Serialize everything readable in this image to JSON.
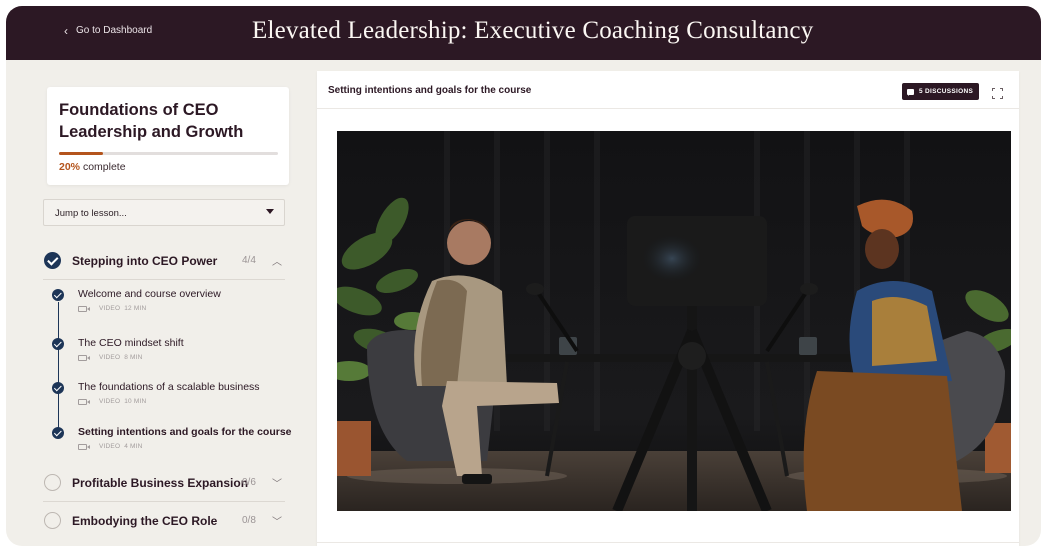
{
  "header": {
    "back_label": "Go to Dashboard",
    "app_title": "Elevated Leadership: Executive Coaching Consultancy"
  },
  "course": {
    "title": "Foundations of CEO Leadership and Growth",
    "progress_pct_label": "20%",
    "progress_text": "complete",
    "progress_fraction": 0.2
  },
  "jump": {
    "label": "Jump to lesson..."
  },
  "modules": [
    {
      "title": "Stepping into CEO Power",
      "count": "4/4",
      "state": "complete",
      "expanded": true,
      "lessons": [
        {
          "title": "Welcome and course overview",
          "type": "VIDEO",
          "duration": "12 MIN"
        },
        {
          "title": "The CEO mindset shift",
          "type": "VIDEO",
          "duration": "8 MIN"
        },
        {
          "title": "The foundations of a scalable business",
          "type": "VIDEO",
          "duration": "10 MIN"
        },
        {
          "title": "Setting intentions and goals for the course",
          "type": "VIDEO",
          "duration": "4 MIN"
        }
      ]
    },
    {
      "title": "Profitable Business Expansion",
      "count": "0/6",
      "state": "incomplete",
      "expanded": false
    },
    {
      "title": "Embodying the CEO Role",
      "count": "0/8",
      "state": "incomplete",
      "expanded": false
    }
  ],
  "lesson_view": {
    "title": "Setting intentions and goals for the course",
    "discussions_label": "5 DISCUSSIONS"
  },
  "icons": {
    "back": "chevron-left-icon",
    "dropdown": "caret-down-icon",
    "check": "check-circle-icon",
    "video": "video-camera-icon",
    "discussion": "chat-bubble-icon",
    "fullscreen": "fullscreen-icon"
  },
  "colors": {
    "header_bg": "#2c1824",
    "accent": "#b4541c",
    "complete": "#1d3557",
    "page_bg": "#f1efea"
  }
}
